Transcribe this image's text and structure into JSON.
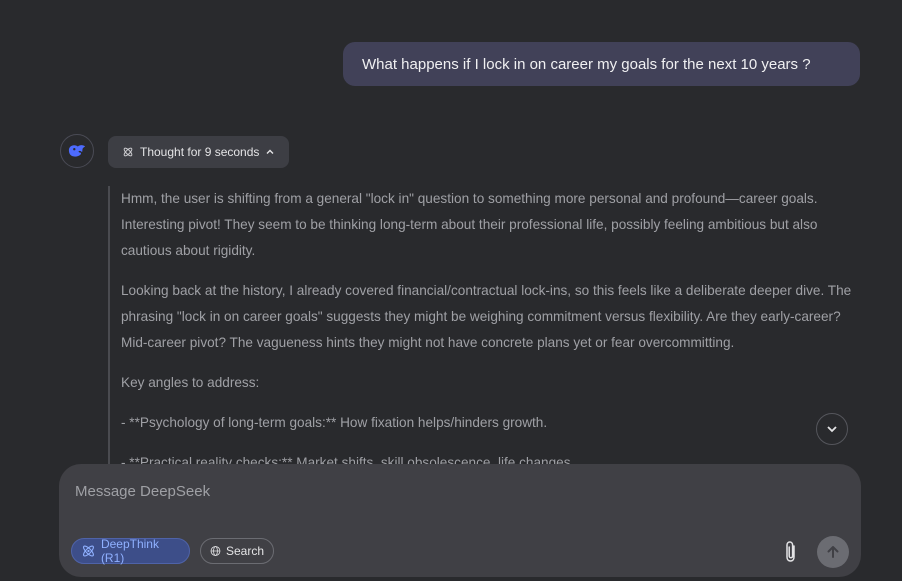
{
  "user_message": "What happens if I lock in on career my goals  for the next 10 years ?",
  "assistant": {
    "thought_label": "Thought for 9 seconds",
    "thinking": {
      "p1": "Hmm, the user is shifting from a general \"lock in\" question to something more personal and profound—career goals. Interesting pivot! They seem to be thinking long-term about their professional life, possibly feeling ambitious but also cautious about rigidity.",
      "p2": "Looking back at the history, I already covered financial/contractual lock-ins, so this feels like a deliberate deeper dive. The phrasing \"lock in on career goals\" suggests they might be weighing commitment versus flexibility. Are they early-career? Mid-career pivot? The vagueness hints they might not have concrete plans yet or fear overcommitting.",
      "p3": "Key angles to address:",
      "p4": "- **Psychology of long-term goals:** How fixation helps/hinders growth.",
      "p5": "- **Practical reality checks:** Market shifts, skill obsolescence, life changes."
    }
  },
  "composer": {
    "placeholder": "Message DeepSeek",
    "deepthink_label": "DeepThink (R1)",
    "search_label": "Search"
  },
  "colors": {
    "accent": "#4d6bfe",
    "background": "#292a2d",
    "user_bubble": "#414158"
  }
}
